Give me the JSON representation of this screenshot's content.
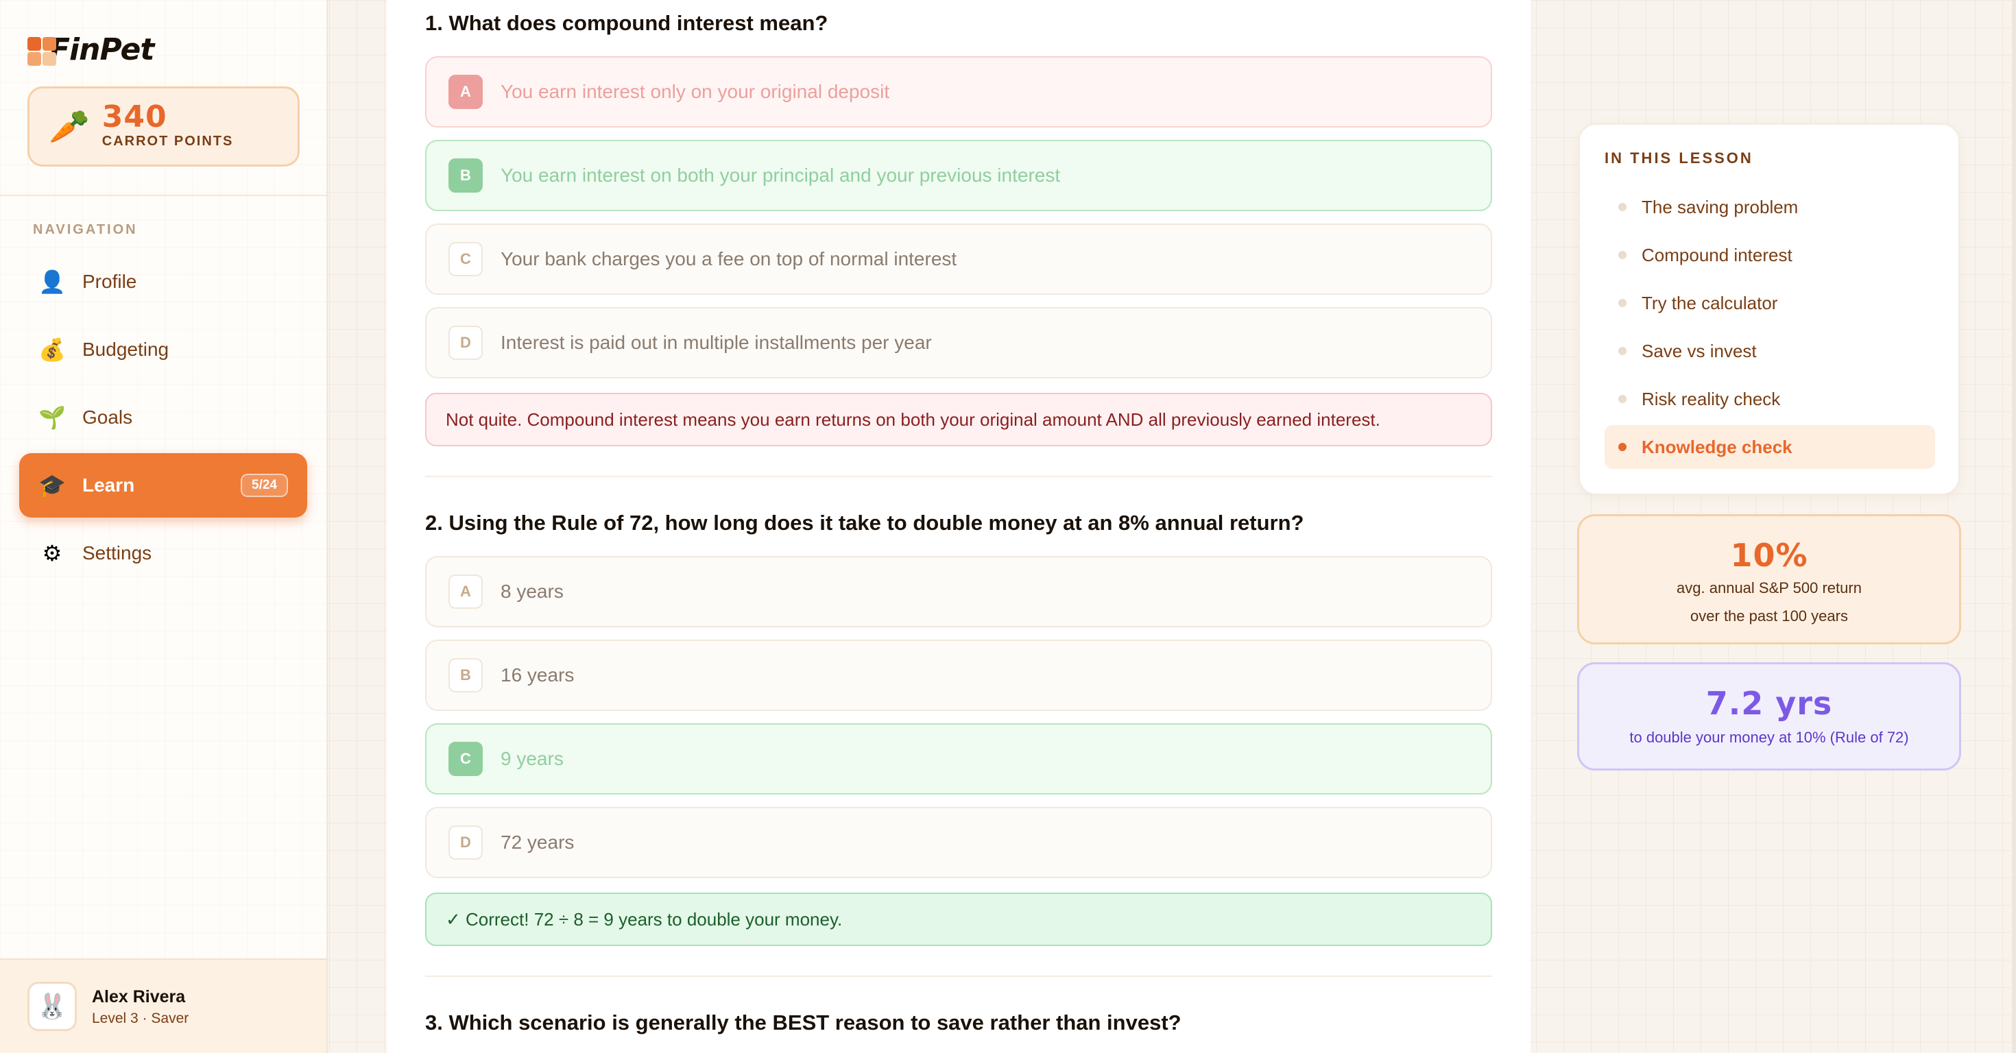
{
  "app": {
    "name": "FinPet"
  },
  "points": {
    "value": "340",
    "label": "CARROT POINTS",
    "icon": "carrot-icon"
  },
  "sidebar": {
    "nav_heading": "NAVIGATION",
    "items": [
      {
        "label": "Profile",
        "icon": "👤",
        "icon_name": "person-icon"
      },
      {
        "label": "Budgeting",
        "icon": "💰",
        "icon_name": "money-bag-icon"
      },
      {
        "label": "Goals",
        "icon": "🌱",
        "icon_name": "seedling-icon"
      },
      {
        "label": "Learn",
        "icon": "🎓",
        "icon_name": "graduation-cap-icon",
        "badge": "5/24",
        "active": true
      },
      {
        "label": "Settings",
        "icon": "⚙",
        "icon_name": "gear-icon"
      }
    ]
  },
  "user": {
    "name": "Alex Rivera",
    "level": "Level 3 · Saver",
    "avatar": "🐰"
  },
  "quiz": {
    "questions": [
      {
        "title": "1. What does compound interest mean?",
        "options": [
          {
            "letter": "A",
            "text": "You earn interest only on your original deposit",
            "state": "wrong"
          },
          {
            "letter": "B",
            "text": "You earn interest on both your principal and your previous interest",
            "state": "right"
          },
          {
            "letter": "C",
            "text": "Your bank charges you a fee on top of normal interest",
            "state": ""
          },
          {
            "letter": "D",
            "text": "Interest is paid out in multiple installments per year",
            "state": ""
          }
        ],
        "feedback": "Not quite. Compound interest means you earn returns on both your original amount AND all previously earned interest."
      },
      {
        "title": "2. Using the Rule of 72, how long does it take to double money at an 8% annual return?",
        "options": [
          {
            "letter": "A",
            "text": "8 years",
            "state": ""
          },
          {
            "letter": "B",
            "text": "16 years",
            "state": ""
          },
          {
            "letter": "C",
            "text": "9 years",
            "state": "right"
          },
          {
            "letter": "D",
            "text": "72 years",
            "state": ""
          }
        ],
        "feedback": "✓ Correct! 72 ÷ 8 = 9 years to double your money."
      },
      {
        "title": "3. Which scenario is generally the BEST reason to save rather than invest?"
      }
    ]
  },
  "lesson": {
    "heading": "IN THIS LESSON",
    "items": [
      {
        "label": "The saving problem"
      },
      {
        "label": "Compound interest"
      },
      {
        "label": "Try the calculator"
      },
      {
        "label": "Save vs invest"
      },
      {
        "label": "Risk reality check"
      },
      {
        "label": "Knowledge check",
        "current": true
      }
    ]
  },
  "stats": {
    "sp500": {
      "value": "10%",
      "line1": "avg. annual S&P 500 return",
      "line2": "over the past 100 years"
    },
    "rule72": {
      "value": "7.2 yrs",
      "line1": "to double your money at 10% (Rule of 72)"
    }
  },
  "colors": {
    "accent": "#e8672a",
    "purple": "#7c5ae6",
    "correct": "#8fcf9e",
    "wrong": "#ec9f9c"
  }
}
